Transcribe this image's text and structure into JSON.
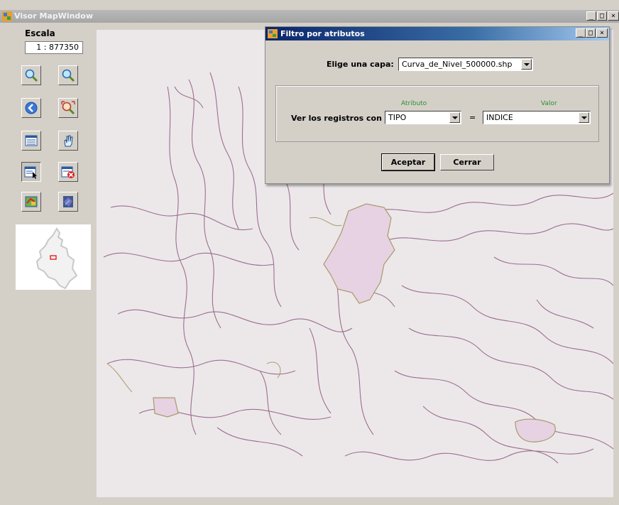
{
  "window": {
    "title": "Visor MapWindow",
    "controls": {
      "minimize": "_",
      "maximize": "□",
      "close": "×"
    }
  },
  "sidebar": {
    "scale_label": "Escala",
    "scale_value": "1 : 877350",
    "tools": [
      {
        "name": "zoom-in-icon"
      },
      {
        "name": "zoom-out-icon"
      },
      {
        "name": "previous-extent-icon"
      },
      {
        "name": "zoom-extent-icon"
      },
      {
        "name": "attribute-table-icon"
      },
      {
        "name": "pan-hand-icon"
      },
      {
        "name": "select-records-icon"
      },
      {
        "name": "clear-selection-icon"
      },
      {
        "name": "layer-refresh-icon"
      },
      {
        "name": "export-map-icon"
      }
    ]
  },
  "dialog": {
    "title": "Filtro por atributos",
    "layer_label": "Elige una capa:",
    "layer_value": "Curva_de_Nivel_500000.shp",
    "records_label": "Ver los registros con",
    "attribute_header": "Atributo",
    "value_header": "Valor",
    "attribute_value": "TIPO",
    "operator": "=",
    "value_value": "INDICE",
    "accept_label": "Aceptar",
    "close_label": "Cerrar"
  },
  "colors": {
    "contour": "#9c6e8e",
    "contour_highlight": "#a89a6a",
    "fill_highlight": "#e6d2e2",
    "map_background": "#ece8ea",
    "dialog_title": "#0a246a"
  }
}
